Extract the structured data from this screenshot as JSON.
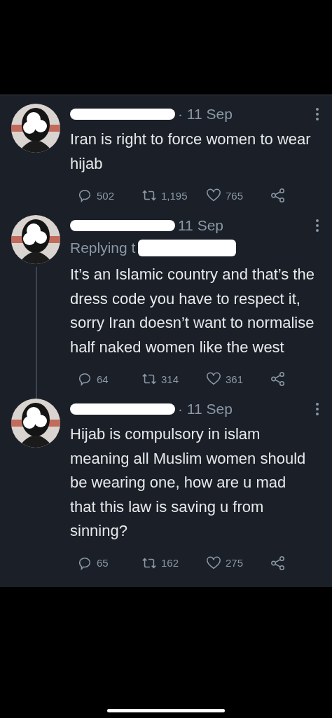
{
  "tweets": [
    {
      "date": "· 11 Sep",
      "text": "Iran is right to force women to wear hijab",
      "replies": "502",
      "retweets": "1,195",
      "likes": "765",
      "thread_line": false
    },
    {
      "date": "11 Sep",
      "replying": "Replying t",
      "text": "It’s an Islamic country and that’s the dress code you have to respect it, sorry Iran doesn’t want to normalise half naked women like the west",
      "replies": "64",
      "retweets": "314",
      "likes": "361",
      "thread_line": true
    },
    {
      "date": "· 11 Sep",
      "text": "Hijab is compulsory in islam meaning all Muslim women should be wearing one, how are u mad that this law is saving u from sinning?",
      "replies": "65",
      "retweets": "162",
      "likes": "275",
      "thread_line": false
    }
  ]
}
